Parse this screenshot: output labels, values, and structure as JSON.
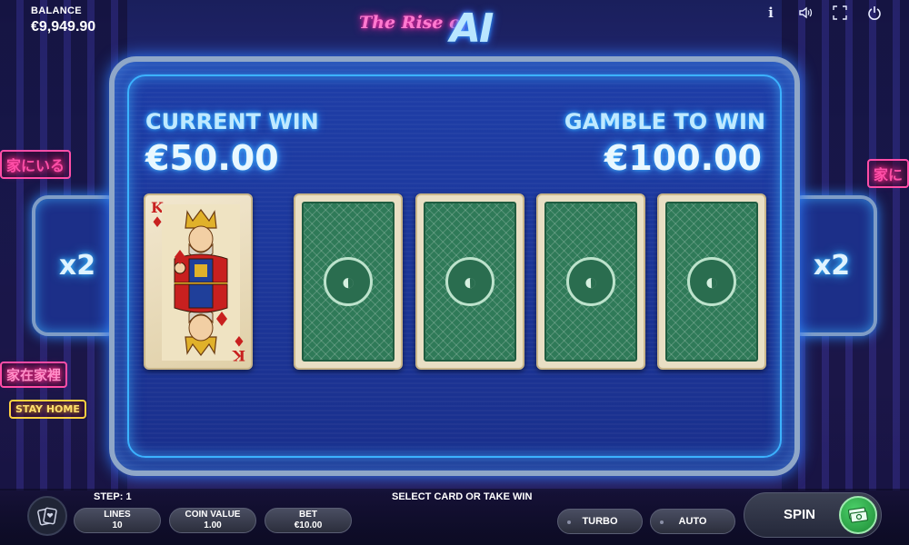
{
  "header": {
    "balance_label": "BALANCE",
    "balance_value": "€9,949.90",
    "logo_script": "The Rise of",
    "logo_main": "AI",
    "icons": [
      "info-icon",
      "sound-icon",
      "fullscreen-icon",
      "power-icon"
    ]
  },
  "gamble": {
    "current_win_label": "CURRENT WIN",
    "current_win_value": "€50.00",
    "gamble_to_win_label": "GAMBLE TO WIN",
    "gamble_to_win_value": "€100.00",
    "multiplier_left": "x2",
    "multiplier_right": "x2",
    "revealed_card": {
      "rank": "K",
      "suit": "diamonds",
      "suit_symbol": "♦"
    },
    "hidden_cards": [
      "card-back",
      "card-back",
      "card-back",
      "card-back"
    ]
  },
  "bottom": {
    "step_label": "STEP: 1",
    "status_message": "SELECT CARD OR TAKE WIN",
    "lines_label": "LINES",
    "lines_value": "10",
    "coin_value_label": "COIN VALUE",
    "coin_value_value": "1.00",
    "bet_label": "BET",
    "bet_value": "€10.00",
    "turbo_label": "TURBO",
    "auto_label": "AUTO",
    "spin_label": "SPIN"
  },
  "colors": {
    "neon_blue": "#3cb2ff",
    "neon_pink": "#ff4fa8",
    "card_back_green": "#2f7a58",
    "spin_green": "#2fb34d"
  }
}
